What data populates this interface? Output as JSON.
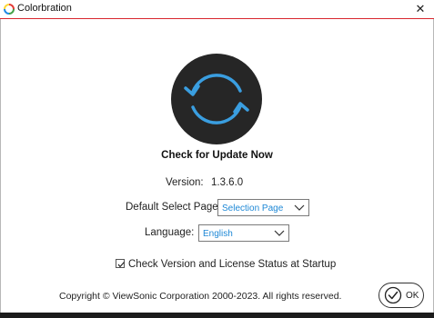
{
  "window": {
    "title": "Colorbration",
    "close_glyph": "✕",
    "app_icon": "colorbration-logo-icon",
    "accent_color": "#d8262e"
  },
  "update": {
    "icon": "refresh-icon",
    "icon_color": "#3a9ee0",
    "button_bg": "#262626",
    "label": "Check for Update Now"
  },
  "version": {
    "label": "Version:",
    "value": "1.3.6.0"
  },
  "default_page": {
    "label": "Default Select Page:",
    "selected": "Selection Page"
  },
  "language": {
    "label": "Language:",
    "selected": "English"
  },
  "startup_check": {
    "label": "Check Version and License Status at Startup",
    "checked": true
  },
  "footer": {
    "copyright": "Copyright © ViewSonic Corporation 2000-2023. All rights reserved.",
    "ok_label": "OK",
    "ok_icon": "checkmark-circle-icon"
  }
}
